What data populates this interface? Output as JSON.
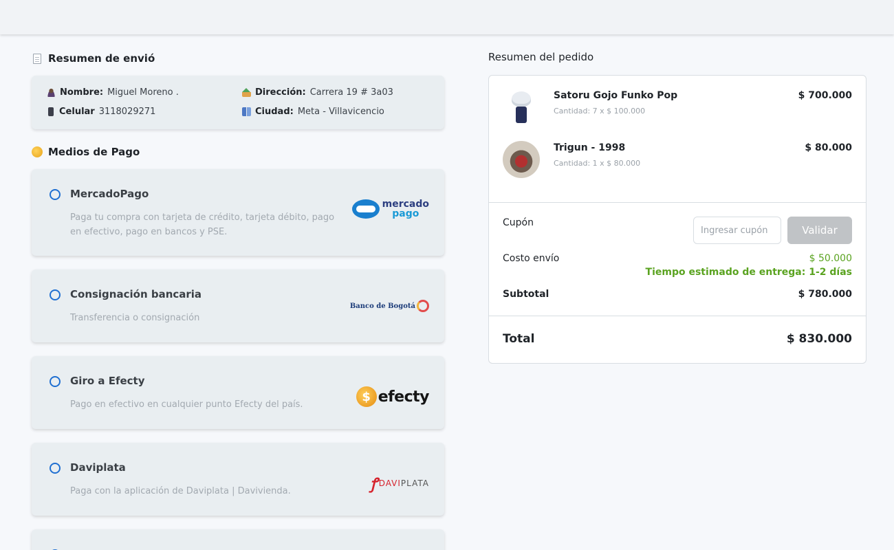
{
  "shipping": {
    "title": "Resumen de envió",
    "name_label": "Nombre:",
    "name_value": "Miguel Moreno .",
    "address_label": "Dirección:",
    "address_value": "Carrera 19 # 3a03",
    "phone_label": "Celular",
    "phone_value": "3118029271",
    "city_label": "Ciudad:",
    "city_value": "Meta - Villavicencio"
  },
  "payment": {
    "title": "Medios de Pago",
    "methods": [
      {
        "name": "MercadoPago",
        "description": "Paga tu compra con tarjeta de crédito, tarjeta débito, pago en efectivo, pago en bancos y PSE.",
        "logo": "mercado-pago-logo",
        "logo_text_1": "mercado",
        "logo_text_2": "pago"
      },
      {
        "name": "Consignación bancaria",
        "description": "Transferencia o consignación",
        "logo": "banco-de-bogota-logo",
        "logo_text_1": "Banco de Bogotá"
      },
      {
        "name": "Giro a Efecty",
        "description": "Pago en efectivo en cualquier punto Efecty del país.",
        "logo": "efecty-logo",
        "logo_text_1": "efecty",
        "logo_text_2": "$"
      },
      {
        "name": "Daviplata",
        "description": "Paga con la aplicación de Daviplata | Davivienda.",
        "logo": "daviplata-logo",
        "logo_text_1": "DAVI",
        "logo_text_2": "PLATA"
      }
    ]
  },
  "order": {
    "title": "Resumen del pedido",
    "products": [
      {
        "name": "Satoru Gojo Funko Pop",
        "quantity": "Cantidad: 7 x $ 100.000",
        "price": "$ 700.000"
      },
      {
        "name": "Trigun - 1998",
        "quantity": "Cantidad: 1 x $ 80.000",
        "price": "$ 80.000"
      }
    ],
    "coupon_label": "Cupón",
    "coupon_placeholder": "Ingresar cupón",
    "validate_label": "Validar",
    "shipping_cost_label": "Costo envío",
    "shipping_cost_value": "$ 50.000",
    "delivery_estimate": "Tiempo estimado de entrega: 1-2 días",
    "subtotal_label": "Subtotal",
    "subtotal_value": "$ 780.000",
    "total_label": "Total",
    "total_value": "$ 830.000"
  },
  "colors": {
    "accent_blue": "#1f6fd1",
    "success_green": "#5aa320",
    "disabled_button": "#c0c3c6"
  }
}
